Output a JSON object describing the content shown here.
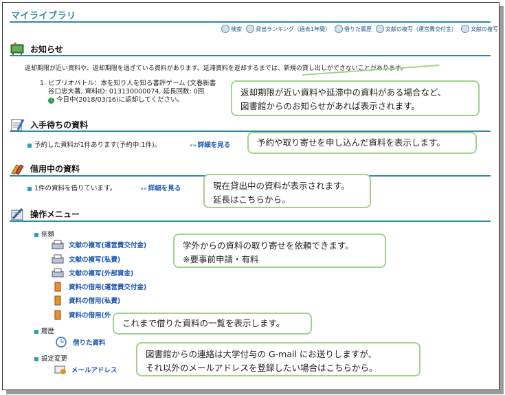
{
  "page_title": "マイライブラリ",
  "toplinks": [
    "検索",
    "貸出ランキング（過去1年間）",
    "借りた履歴",
    "文献の複写（運営費交付金）",
    "文献の複写"
  ],
  "notice": {
    "heading": "お知らせ",
    "message": "返却期限が近い資料や、返却期限を過ぎている資料があります。延滞資料を返却するまでは、新規の貸し出しができないことがあります。",
    "item_line1": "1. ビブリオバトル：本を知り人を知る書評ゲーム (文春新書",
    "item_line2": "谷口忠大著, 資料ID: 013130000074, 延長回数: 0回",
    "item_line3": "今日中(2018/03/16)に返却してください。"
  },
  "waiting": {
    "heading": "入手待ちの資料",
    "text": "予約した資料が1件あります(予約中:1件)。",
    "link": "詳細を見る"
  },
  "borrowing": {
    "heading": "借用中の資料",
    "text": "1件の資料を借りています。",
    "link": "詳細を見る"
  },
  "menu": {
    "heading": "操作メニュー",
    "group_request": "依頼",
    "items_request": [
      "文献の複写(運営費交付金)",
      "文献の複写(私費)",
      "文献の複写(外部資金)",
      "資料の借用(運営費交付金)",
      "資料の借用(私費)",
      "資料の借用(外"
    ],
    "group_history": "履歴",
    "item_history": "借りた資料",
    "group_settings": "設定変更",
    "item_settings": "メールアドレス"
  },
  "callouts": {
    "notice_1": "返却期限が近い資料や延滞中の資料がある場合など、",
    "notice_2": "図書館からのお知らせがあれば表示されます。",
    "waiting": "予約や取り寄せを申し込んだ資料を表示します。",
    "borrowing_1": "現在貸出中の資料が表示されます。",
    "borrowing_2": "延長はこちらから。",
    "request_1": "学外からの資料の取り寄せを依頼できます。",
    "request_2": "※要事前申請・有料",
    "history": "これまで借りた資料の一覧を表示します。",
    "mail_1": "図書館からの連絡は大学付与の G-mail にお送りしますが、",
    "mail_2": "それ以外のメールアドレスを登録したい場合はこちらから。"
  },
  "colors": {
    "accent": "#2a8aa8",
    "link": "#1a55b0",
    "callout_border": "#9fd28c"
  }
}
